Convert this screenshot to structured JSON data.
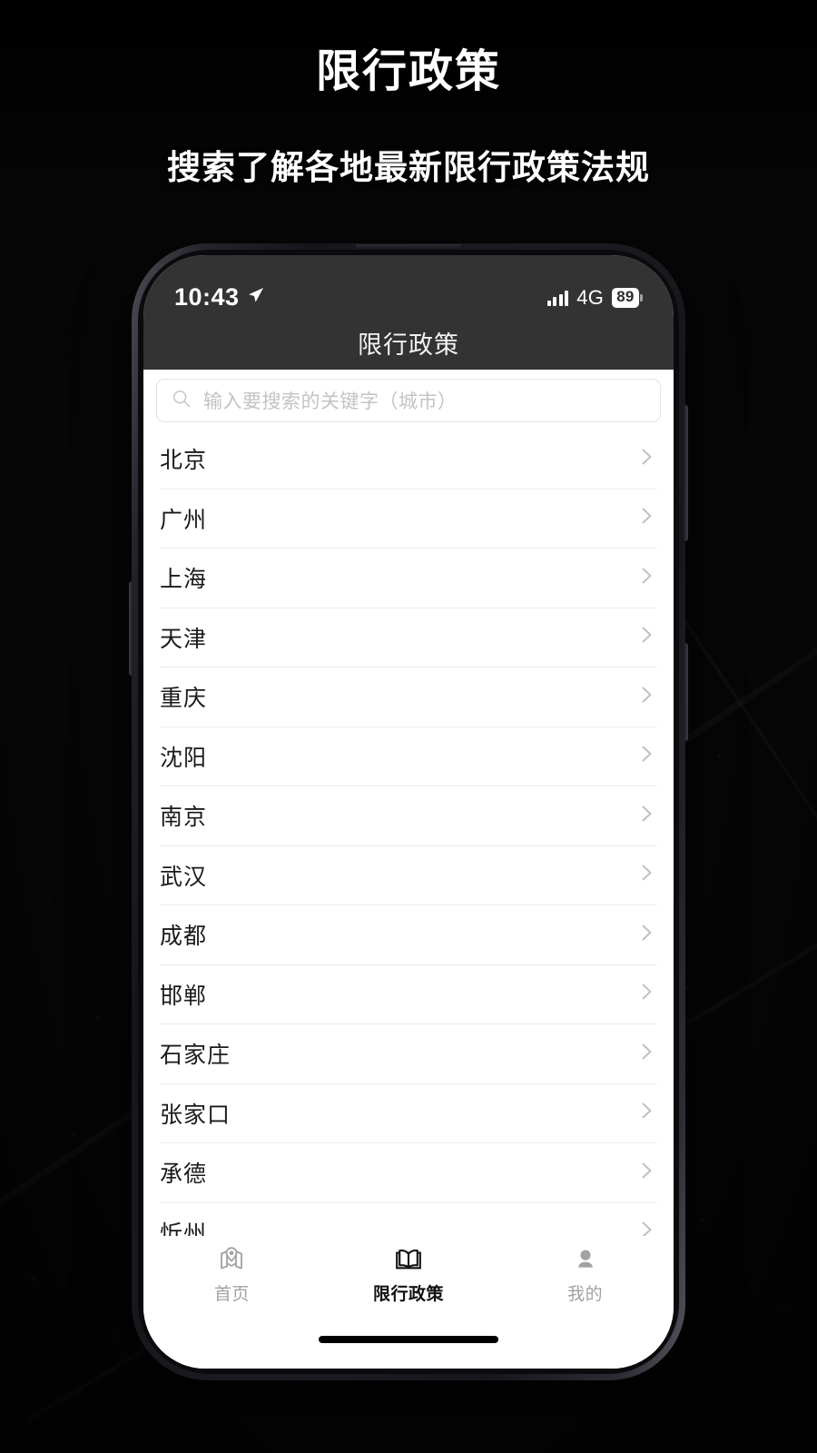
{
  "promo": {
    "title": "限行政策",
    "subtitle": "搜索了解各地最新限行政策法规"
  },
  "phone": {
    "status_bar": {
      "time": "10:43",
      "location_icon": "location-arrow-icon",
      "signal_icon": "signal-bars-icon",
      "network": "4G",
      "battery_level": "89",
      "battery_icon": "battery-icon"
    },
    "nav_bar": {
      "title": "限行政策"
    },
    "search": {
      "icon": "search-icon",
      "value": "",
      "placeholder": "输入要搜索的关键字（城市）"
    },
    "city_list": {
      "chevron_icon": "chevron-right-icon",
      "items": [
        {
          "name": "北京"
        },
        {
          "name": "广州"
        },
        {
          "name": "上海"
        },
        {
          "name": "天津"
        },
        {
          "name": "重庆"
        },
        {
          "name": "沈阳"
        },
        {
          "name": "南京"
        },
        {
          "name": "武汉"
        },
        {
          "name": "成都"
        },
        {
          "name": "邯郸"
        },
        {
          "name": "石家庄"
        },
        {
          "name": "张家口"
        },
        {
          "name": "承德"
        },
        {
          "name": "忻州"
        }
      ]
    },
    "tab_bar": {
      "tabs": [
        {
          "label": "首页",
          "icon": "map-pin-icon",
          "active": false
        },
        {
          "label": "限行政策",
          "icon": "open-book-icon",
          "active": true
        },
        {
          "label": "我的",
          "icon": "person-icon",
          "active": false
        }
      ]
    },
    "home_indicator": "home-indicator"
  },
  "colors": {
    "page_background": "#0a0a0a",
    "status_bar": "#333333",
    "nav_bar": "#333333",
    "screen_background": "#ffffff",
    "row_divider": "#ececec",
    "placeholder_text": "#c3c3c6",
    "tab_active": "#121212",
    "tab_inactive": "#a2a2a2",
    "promo_text": "#ffffff"
  }
}
